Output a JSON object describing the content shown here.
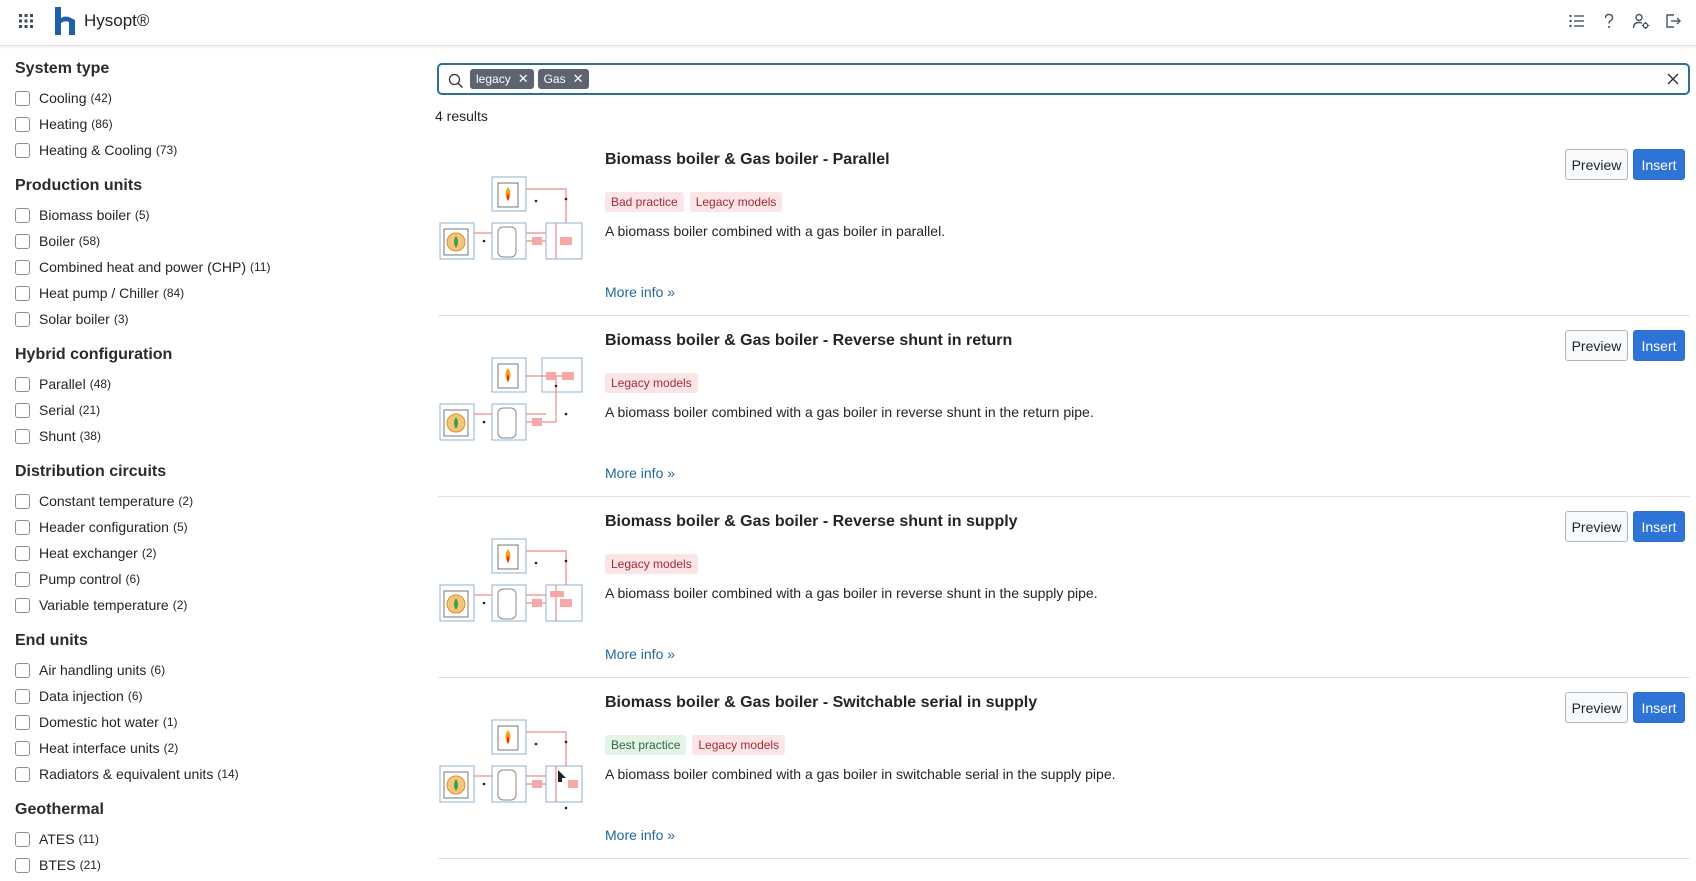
{
  "app": {
    "name": "Hysopt®"
  },
  "nav_icons": [
    "apps-grid-icon",
    "list-icon",
    "help-icon",
    "user-settings-icon",
    "logout-icon"
  ],
  "sidebar": {
    "groups": [
      {
        "title": "System type",
        "items": [
          {
            "label": "Cooling",
            "count": "(42)"
          },
          {
            "label": "Heating",
            "count": "(86)"
          },
          {
            "label": "Heating & Cooling",
            "count": "(73)"
          }
        ]
      },
      {
        "title": "Production units",
        "items": [
          {
            "label": "Biomass boiler",
            "count": "(5)"
          },
          {
            "label": "Boiler",
            "count": "(58)"
          },
          {
            "label": "Combined heat and power (CHP)",
            "count": "(11)"
          },
          {
            "label": "Heat pump / Chiller",
            "count": "(84)"
          },
          {
            "label": "Solar boiler",
            "count": "(3)"
          }
        ]
      },
      {
        "title": "Hybrid configuration",
        "items": [
          {
            "label": "Parallel",
            "count": "(48)"
          },
          {
            "label": "Serial",
            "count": "(21)"
          },
          {
            "label": "Shunt",
            "count": "(38)"
          }
        ]
      },
      {
        "title": "Distribution circuits",
        "items": [
          {
            "label": "Constant temperature",
            "count": "(2)"
          },
          {
            "label": "Header configuration",
            "count": "(5)"
          },
          {
            "label": "Heat exchanger",
            "count": "(2)"
          },
          {
            "label": "Pump control",
            "count": "(6)"
          },
          {
            "label": "Variable temperature",
            "count": "(2)"
          }
        ]
      },
      {
        "title": "End units",
        "items": [
          {
            "label": "Air handling units",
            "count": "(6)"
          },
          {
            "label": "Data injection",
            "count": "(6)"
          },
          {
            "label": "Domestic hot water",
            "count": "(1)"
          },
          {
            "label": "Heat interface units",
            "count": "(2)"
          },
          {
            "label": "Radiators & equivalent units",
            "count": "(14)"
          }
        ]
      },
      {
        "title": "Geothermal",
        "items": [
          {
            "label": "ATES",
            "count": "(11)"
          },
          {
            "label": "BTES",
            "count": "(21)"
          }
        ]
      }
    ]
  },
  "search": {
    "chips": [
      "legacy",
      "Gas"
    ],
    "value": "",
    "placeholder": ""
  },
  "results_count": "4 results",
  "results": [
    {
      "title": "Biomass boiler & Gas boiler - Parallel",
      "tags": [
        {
          "label": "Bad practice",
          "kind": "bad"
        },
        {
          "label": "Legacy models",
          "kind": "legacy"
        }
      ],
      "description": "A biomass boiler combined with a gas boiler in parallel.",
      "more": "More info »",
      "preview": "Preview",
      "insert": "Insert"
    },
    {
      "title": "Biomass boiler & Gas boiler - Reverse shunt in return",
      "tags": [
        {
          "label": "Legacy models",
          "kind": "legacy"
        }
      ],
      "description": "A biomass boiler combined with a gas boiler in reverse shunt in the return pipe.",
      "more": "More info »",
      "preview": "Preview",
      "insert": "Insert"
    },
    {
      "title": "Biomass boiler & Gas boiler - Reverse shunt in supply",
      "tags": [
        {
          "label": "Legacy models",
          "kind": "legacy"
        }
      ],
      "description": "A biomass boiler combined with a gas boiler in reverse shunt in the supply pipe.",
      "more": "More info »",
      "preview": "Preview",
      "insert": "Insert"
    },
    {
      "title": "Biomass boiler & Gas boiler - Switchable serial in supply",
      "tags": [
        {
          "label": "Best practice",
          "kind": "best"
        },
        {
          "label": "Legacy models",
          "kind": "legacy"
        }
      ],
      "description": "A biomass boiler combined with a gas boiler in switchable serial in the supply pipe.",
      "more": "More info »",
      "preview": "Preview",
      "insert": "Insert"
    }
  ],
  "colors": {
    "accent": "#2d74d6",
    "search_border": "#2f6f93",
    "chip": "#5b6470",
    "link": "#23689b",
    "legacy_tag_bg": "#fbe5e6",
    "best_tag_bg": "#e3f3e6"
  }
}
